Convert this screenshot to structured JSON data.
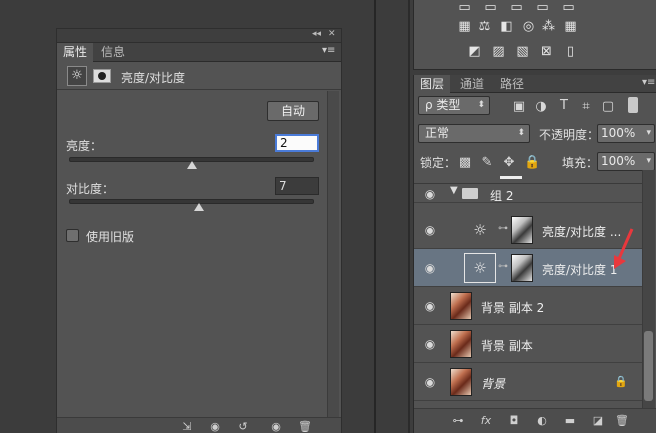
{
  "properties_panel": {
    "collapse_glyph": "◂◂",
    "close_glyph": "✕",
    "menu_glyph": "▾≡",
    "tabs": [
      {
        "label": "属性",
        "active": true
      },
      {
        "label": "信息",
        "active": false
      }
    ],
    "header_title": "亮度/对比度",
    "auto_button_label": "自动",
    "brightness": {
      "label": "亮度：",
      "value": "2",
      "slider_fraction": 0.5
    },
    "contrast": {
      "label": "对比度：",
      "value": "7",
      "slider_fraction": 0.53
    },
    "legacy_checkbox": {
      "label": "使用旧版",
      "checked": false
    },
    "footer_icons": [
      "clip-to-layer-icon",
      "view-previous-icon",
      "reset-icon",
      "visibility-eye-icon",
      "trash-icon"
    ]
  },
  "layers_panel": {
    "tabs": [
      {
        "label": "图层",
        "active": true
      },
      {
        "label": "通道",
        "active": false
      },
      {
        "label": "路径",
        "active": false
      }
    ],
    "filter_kind_label": "ρ 类型",
    "blend_mode": "正常",
    "opacity_label": "不透明度：",
    "opacity_value": "100%",
    "lock_label": "锁定：",
    "fill_label": "填充：",
    "fill_value": "100%",
    "layers": [
      {
        "name": "组 2",
        "type": "group"
      },
      {
        "name": "亮度/对比度 ...",
        "type": "adjustment",
        "selected": false
      },
      {
        "name": "亮度/对比度 1",
        "type": "adjustment",
        "selected": true
      },
      {
        "name": "背景 副本 2",
        "type": "image"
      },
      {
        "name": "背景 副本",
        "type": "image"
      },
      {
        "name": "背景",
        "type": "image",
        "locked": true
      }
    ],
    "accent_arrow_color": "#e8383d",
    "selected_row_color": "#687583"
  },
  "glyphs": {
    "eye": "👁",
    "folder": "▬",
    "caret_down": "▾",
    "sun": "☼",
    "chain": "⊶",
    "lock": "🔒",
    "menu": "≡"
  }
}
